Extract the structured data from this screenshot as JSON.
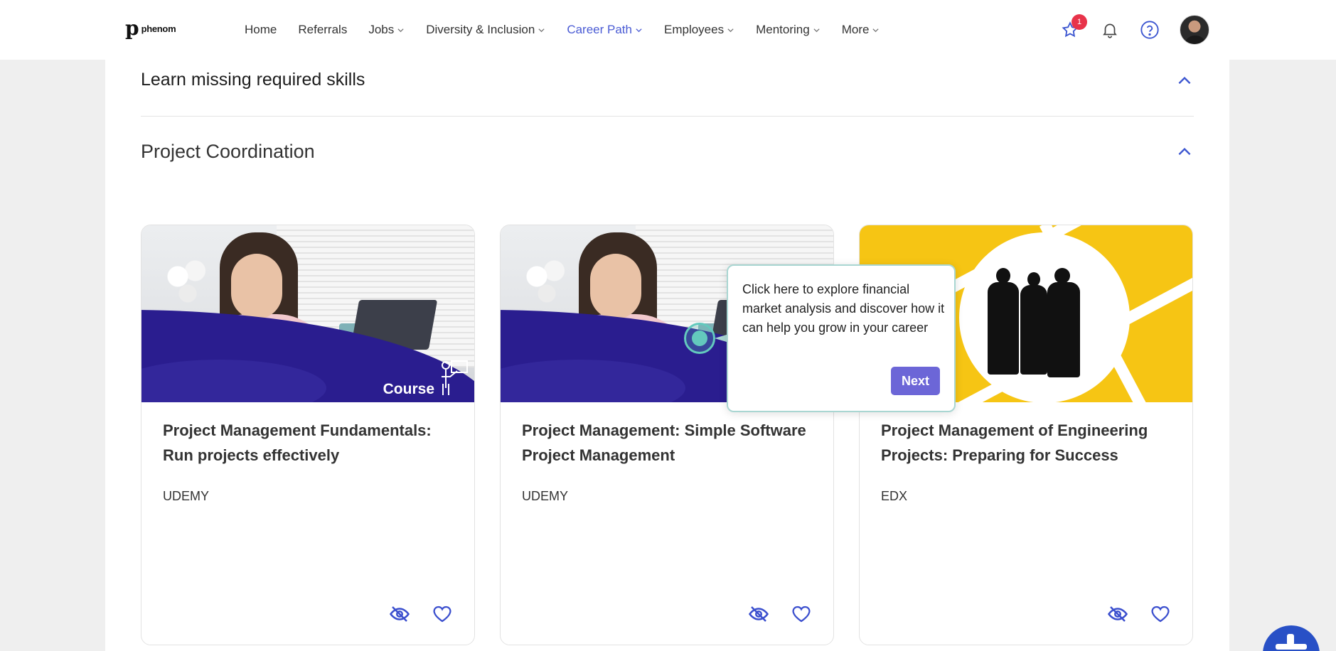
{
  "logo": {
    "text": "phenom"
  },
  "nav": [
    {
      "label": "Home",
      "dropdown": false,
      "active": false
    },
    {
      "label": "Referrals",
      "dropdown": false,
      "active": false
    },
    {
      "label": "Jobs",
      "dropdown": true,
      "active": false
    },
    {
      "label": "Diversity & Inclusion",
      "dropdown": true,
      "active": false
    },
    {
      "label": "Career Path",
      "dropdown": true,
      "active": true
    },
    {
      "label": "Employees",
      "dropdown": true,
      "active": false
    },
    {
      "label": "Mentoring",
      "dropdown": true,
      "active": false
    },
    {
      "label": "More",
      "dropdown": true,
      "active": false
    }
  ],
  "header_icons": {
    "favorites_badge": "1",
    "accent_color": "#4a5bd4"
  },
  "section": {
    "title": "Learn missing required skills",
    "subtitle": "Project Coordination"
  },
  "cards": [
    {
      "image": "course-woman-laptop",
      "image_label": "Course",
      "title": "Project Management Fundamentals: Run projects effectively",
      "provider": "UDEMY"
    },
    {
      "image": "course-woman-laptop",
      "image_label": "",
      "title": "Project Management: Simple Software Project Management",
      "provider": "UDEMY"
    },
    {
      "image": "engineering-silhouettes",
      "image_label": "",
      "title": "Project Management of Engineering Projects: Preparing for Success",
      "provider": "EDX"
    }
  ],
  "tooltip": {
    "text": "Click here to explore financial market analysis and discover how it can help you grow in your career",
    "next_label": "Next",
    "button_color": "#6c66d7"
  }
}
